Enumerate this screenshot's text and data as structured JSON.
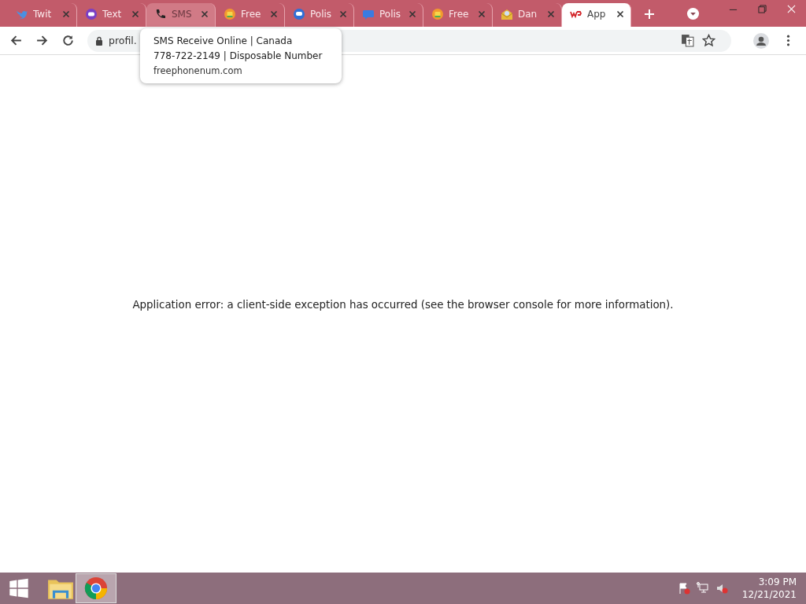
{
  "tabs": [
    {
      "title": "Twit",
      "kind": "bird",
      "selected": false,
      "hovered": false
    },
    {
      "title": "Text",
      "kind": "chat",
      "selected": false,
      "hovered": false
    },
    {
      "title": "SMS",
      "kind": "phone",
      "selected": false,
      "hovered": true
    },
    {
      "title": "Free",
      "kind": "mailbox",
      "selected": false,
      "hovered": false
    },
    {
      "title": "Polis",
      "kind": "bubble",
      "selected": false,
      "hovered": false
    },
    {
      "title": "Polis",
      "kind": "sms",
      "selected": false,
      "hovered": false
    },
    {
      "title": "Free",
      "kind": "mailbox",
      "selected": false,
      "hovered": false
    },
    {
      "title": "Dan",
      "kind": "envelope",
      "selected": false,
      "hovered": false
    },
    {
      "title": "App",
      "kind": "logo",
      "selected": true,
      "hovered": false
    }
  ],
  "tooltip": {
    "title": "SMS Receive Online | Canada",
    "subtitle": "778-722-2149 | Disposable Number",
    "domain": "freephonenum.com"
  },
  "address": {
    "value": "profil."
  },
  "message": "Application error: a client-side exception has occurred (see the browser console for more information).",
  "taskbar": {
    "time": "3:09 PM",
    "date": "12/21/2021"
  }
}
